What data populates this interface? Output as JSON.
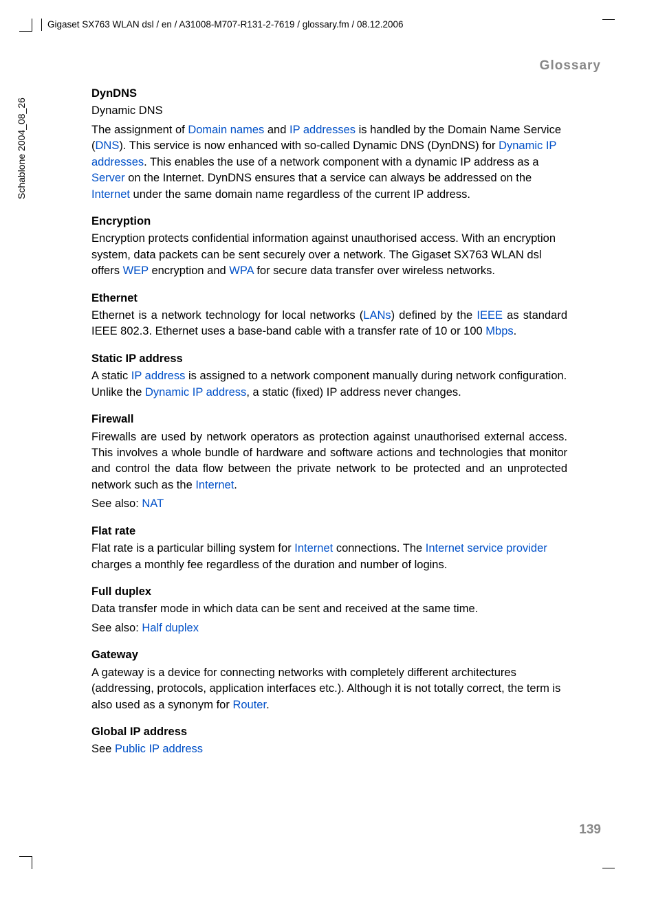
{
  "headerPath": "Gigaset SX763 WLAN dsl / en / A31008-M707-R131-2-7619 / glossary.fm / 08.12.2006",
  "sideText": "Schablone 2004_08_26",
  "sectionTitle": "Glossary",
  "pageNumber": "139",
  "entries": {
    "dyndns_term": "DynDNS",
    "dyndns_sub": "Dynamic DNS",
    "dyndns_p1a": "The assignment of ",
    "dyndns_l1": "Domain names",
    "dyndns_p1b": " and ",
    "dyndns_l2": "IP addresses",
    "dyndns_p1c": " is handled by the Domain Name Service (",
    "dyndns_l3": "DNS",
    "dyndns_p1d": "). This service is now enhanced with so-called Dynamic DNS (DynDNS) for ",
    "dyndns_l4": "Dynamic IP addresses",
    "dyndns_p1e": ". This enables the use of a network component with a dynamic IP address as a ",
    "dyndns_l5": "Server",
    "dyndns_p1f": " on the Internet. DynDNS ensures that a service can always be addressed on the ",
    "dyndns_l6": "Internet",
    "dyndns_p1g": " under the same domain name regardless of the current IP address.",
    "enc_term": "Encryption",
    "enc_p1a": "Encryption protects confidential information against unauthorised access. With an encryption system, data packets can be sent securely over a network. The Gigaset SX763 WLAN dsl offers ",
    "enc_l1": "WEP",
    "enc_p1b": " encryption and ",
    "enc_l2": "WPA",
    "enc_p1c": " for secure data transfer over wireless networks.",
    "eth_term": "Ethernet",
    "eth_p1a": "Ethernet is a network technology for local networks (",
    "eth_l1": "LANs",
    "eth_p1b": ") defined by the ",
    "eth_l2": "IEEE",
    "eth_p1c": " as standard IEEE 802.3. Ethernet uses a base-band cable with a transfer rate of 10 or 100 ",
    "eth_l3": "Mbps",
    "eth_p1d": ".",
    "sip_term": "Static IP address",
    "sip_p1a": "A static ",
    "sip_l1": "IP address",
    "sip_p1b": " is assigned to a network component manually during network configuration. Unlike the ",
    "sip_l2": "Dynamic IP address",
    "sip_p1c": ", a static (fixed) IP address never changes.",
    "fw_term": "Firewall",
    "fw_p1a": "Firewalls are used by network operators as protection against unauthorised external access. This involves a whole bundle of hardware and software actions and technologies that monitor and control the data flow between the private network to be protected and an unprotected network such as the ",
    "fw_l1": "Internet",
    "fw_p1b": ".",
    "fw_p2a": "See also: ",
    "fw_l2": "NAT",
    "fr_term": "Flat rate",
    "fr_p1a": "Flat rate is a particular billing system for ",
    "fr_l1": "Internet",
    "fr_p1b": " connections. The ",
    "fr_l2": "Internet service provider",
    "fr_p1c": " charges a monthly fee regardless of the duration and number of logins.",
    "fd_term": "Full duplex",
    "fd_p1": "Data transfer mode in which data can be sent and received at the same time.",
    "fd_p2a": "See also: ",
    "fd_l1": "Half duplex",
    "gw_term": "Gateway",
    "gw_p1a": "A gateway is a device for connecting networks with completely different architectures (addressing, protocols, application interfaces etc.). Although it is not totally correct, the term is also used as a synonym for ",
    "gw_l1": "Router",
    "gw_p1b": ".",
    "gip_term": "Global IP address",
    "gip_p1a": "See ",
    "gip_l1": "Public IP address"
  }
}
